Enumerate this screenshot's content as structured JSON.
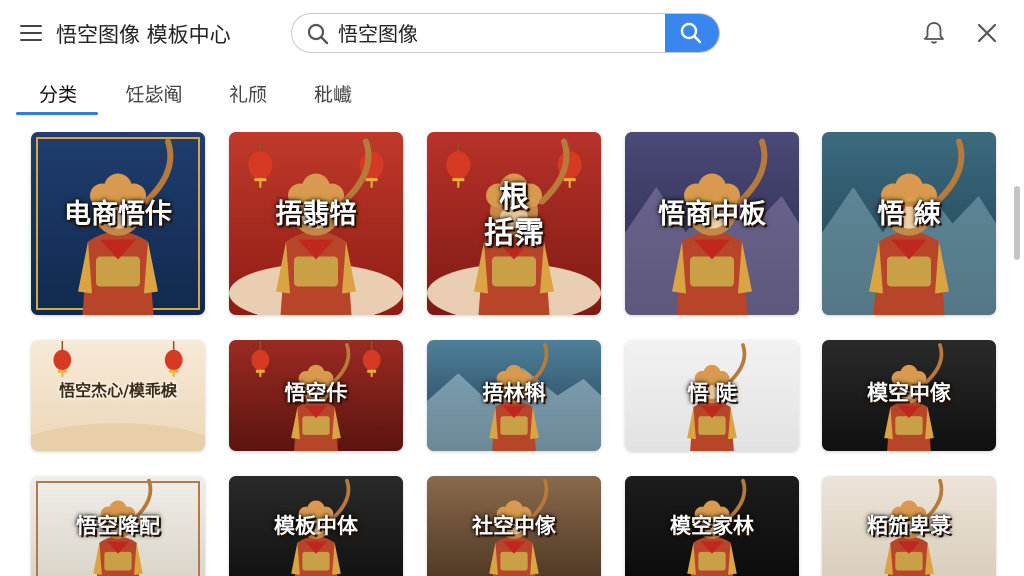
{
  "header": {
    "title": "悟空图像 模板中心",
    "search_value": "悟空图像",
    "menu_icon": "hamburger-icon",
    "bell_icon": "bell-icon",
    "close_icon": "close-icon",
    "accent": "#3a86f0"
  },
  "tabs": [
    {
      "label": "分类",
      "active": true
    },
    {
      "label": "饪毖阄",
      "active": false
    },
    {
      "label": "礼颀",
      "active": false
    },
    {
      "label": "秕巇",
      "active": false
    }
  ],
  "cards": [
    {
      "title": "电商悟佧",
      "theme": "blue-poster"
    },
    {
      "title": "捂翡犃",
      "theme": "red-festival"
    },
    {
      "title": "根\n括霈",
      "theme": "red-tea"
    },
    {
      "title": "悟商中板",
      "theme": "mountain-purple"
    },
    {
      "title": "悟 綀",
      "theme": "mountain-teal"
    },
    {
      "title": "悟空杰心/模乖棙",
      "theme": "cream"
    },
    {
      "title": "悟空佧",
      "theme": "red-curtain"
    },
    {
      "title": "捂林犐",
      "theme": "mountain-blue"
    },
    {
      "title": "悟 陡",
      "theme": "white"
    },
    {
      "title": "模空中傢",
      "theme": "black"
    },
    {
      "title": "悟空降配",
      "theme": "ornate"
    },
    {
      "title": "模板中体",
      "theme": "black"
    },
    {
      "title": "社空中傢",
      "theme": "sepia"
    },
    {
      "title": "模空家林",
      "theme": "black-red"
    },
    {
      "title": "粨笳卑菉",
      "theme": "beige"
    }
  ]
}
